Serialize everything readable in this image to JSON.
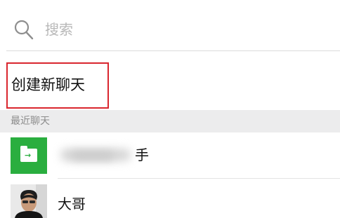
{
  "search": {
    "placeholder": "搜索",
    "icon": "search-icon"
  },
  "new_chat": {
    "label": "创建新聊天",
    "highlight_color": "#d9262e"
  },
  "recent_section": {
    "header": "最近聊天"
  },
  "contacts": [
    {
      "name_visible": "手",
      "name_obscured": true,
      "avatar": "file-transfer-icon",
      "avatar_color": "#2aae3f"
    },
    {
      "name_visible": "大哥",
      "name_obscured": false,
      "avatar": "person-photo"
    }
  ]
}
